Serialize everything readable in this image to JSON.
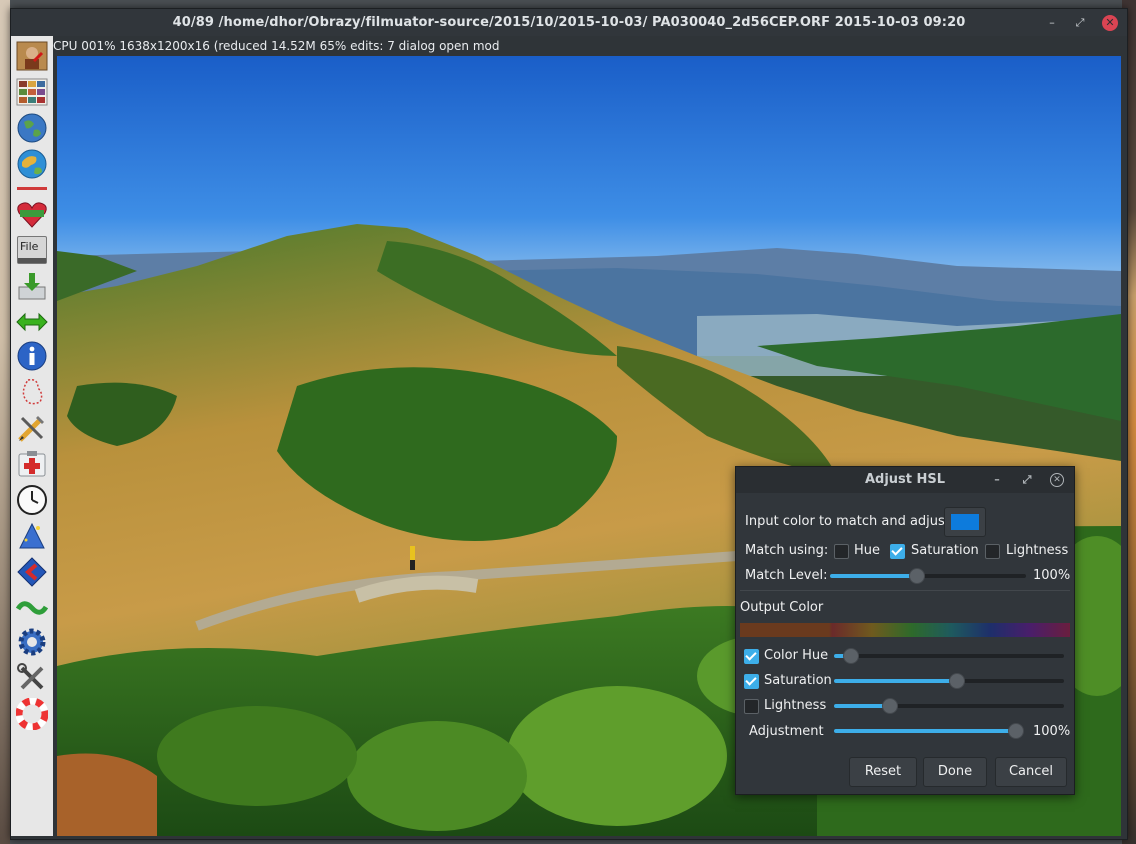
{
  "window": {
    "title": "40/89  /home/dhor/Obrazy/filmuator-source/2015/10/2015-10-03/  PA030040_2d56CEP.ORF  2015-10-03 09:20",
    "minimize": "–",
    "maximize": "⤢",
    "close": "✕"
  },
  "status": {
    "text": "CPU 001%  1638x1200x16 (reduced  14.52M  65%  edits: 7  dialog open  mod"
  },
  "sidebar": {
    "tools": [
      {
        "name": "edit-image-icon"
      },
      {
        "name": "gallery-icon"
      },
      {
        "name": "globe-icon"
      },
      {
        "name": "world-map-icon"
      },
      {
        "name": "divider-icon"
      },
      {
        "name": "favorites-icon",
        "label": "FAV"
      },
      {
        "name": "file-menu-icon",
        "label": "File"
      },
      {
        "name": "save-icon"
      },
      {
        "name": "prev-next-icon"
      },
      {
        "name": "info-icon"
      },
      {
        "name": "select-area-icon"
      },
      {
        "name": "edit-tools-icon"
      },
      {
        "name": "repair-icon"
      },
      {
        "name": "clock-icon"
      },
      {
        "name": "magic-icon"
      },
      {
        "name": "batch-icon"
      },
      {
        "name": "link-icon"
      },
      {
        "name": "settings-icon"
      },
      {
        "name": "tools-icon"
      },
      {
        "name": "help-icon"
      }
    ]
  },
  "dialog": {
    "title": "Adjust HSL",
    "minimize": "–",
    "maximize": "⤢",
    "close": "✕",
    "input_color_label": "Input color to match and adjust:",
    "input_color": "#0d7bdc",
    "match_using_label": "Match using:",
    "match_options": [
      {
        "label": "Hue",
        "checked": false
      },
      {
        "label": "Saturation",
        "checked": true
      },
      {
        "label": "Lightness",
        "checked": false
      }
    ],
    "match_level_label": "Match Level:",
    "match_level_value": "100%",
    "match_level_fraction": 0.44,
    "output_color_label": "Output Color",
    "adjustments": [
      {
        "label": "Color Hue",
        "checked": true,
        "fraction": 0.07
      },
      {
        "label": "Saturation",
        "checked": true,
        "fraction": 0.53
      },
      {
        "label": "Lightness",
        "checked": false,
        "fraction": 0.24
      }
    ],
    "adjustment_label": "Adjustment",
    "adjustment_value": "100%",
    "adjustment_fraction": 0.95,
    "buttons": {
      "reset": "Reset",
      "done": "Done",
      "cancel": "Cancel"
    }
  }
}
